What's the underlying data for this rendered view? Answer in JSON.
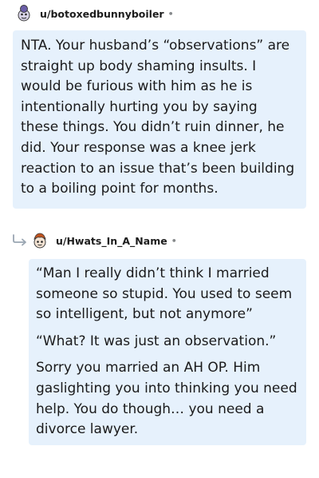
{
  "comment1": {
    "username": "u/botoxedbunnyboiler",
    "separator": "•",
    "avatar_icon": "snoo-avatar-icon",
    "paragraphs": [
      "NTA. Your husband’s “observations” are straight up body shaming insults. I would be furious with him as he is intentionally hurting you by saying these things. You didn’t ruin dinner, he did. Your response was a knee jerk reaction to an issue that’s been building to a boiling point for months."
    ]
  },
  "comment2": {
    "username": "u/Hwats_In_A_Name",
    "separator": "•",
    "avatar_icon": "snoo-avatar-icon",
    "reply_icon": "reply-arrow-icon",
    "paragraphs": [
      "“Man I really didn’t think I married someone so stupid. You used to seem so intelligent, but not anymore”",
      "“What? It was just an observation.”",
      "Sorry you married an AH OP. Him gaslighting you into thinking you need help. You do though… you need a divorce lawyer."
    ]
  },
  "colors": {
    "bubble_bg": "#e6f1fc",
    "text": "#1a1a1b",
    "muted": "#878a8c"
  }
}
